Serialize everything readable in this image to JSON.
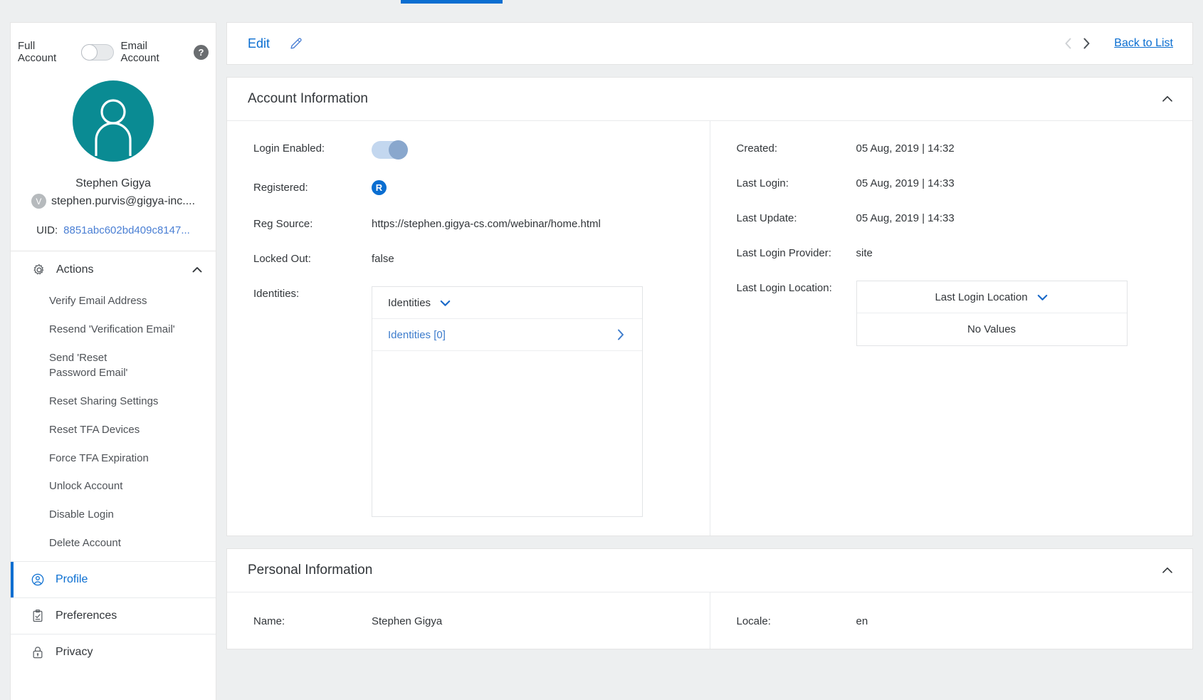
{
  "sidebar": {
    "account_toggle": {
      "left_label": "Full Account",
      "right_label": "Email Account",
      "help_glyph": "?",
      "state": "off"
    },
    "user": {
      "name": "Stephen Gigya",
      "email": "stephen.purvis@gigya-inc....",
      "verified_glyph": "V",
      "uid_label": "UID:",
      "uid_value": "8851abc602bd409c8147..."
    },
    "actions": {
      "title": "Actions",
      "expanded": true,
      "items": [
        {
          "label": "Verify Email Address"
        },
        {
          "label": "Resend 'Verification Email'"
        },
        {
          "label": "Send 'Reset Password Email'"
        },
        {
          "label": "Reset Sharing Settings"
        },
        {
          "label": "Reset TFA Devices"
        },
        {
          "label": "Force TFA Expiration"
        },
        {
          "label": "Unlock Account"
        },
        {
          "label": "Disable Login"
        },
        {
          "label": "Delete Account"
        }
      ]
    },
    "nav": [
      {
        "label": "Profile",
        "icon": "person-circle-icon",
        "active": true
      },
      {
        "label": "Preferences",
        "icon": "clipboard-check-icon",
        "active": false
      },
      {
        "label": "Privacy",
        "icon": "lock-icon",
        "active": false
      }
    ]
  },
  "toolbar": {
    "edit_label": "Edit",
    "edit_icon": "pencil-icon",
    "prev_icon": "chevron-left-icon",
    "next_icon": "chevron-right-icon",
    "back_label": "Back to List"
  },
  "account_information": {
    "title": "Account Information",
    "left_fields": [
      {
        "label": "Login Enabled:",
        "type": "toggle",
        "value": "on"
      },
      {
        "label": "Registered:",
        "type": "badge",
        "value": "R"
      },
      {
        "label": "Reg Source:",
        "type": "text",
        "value": "https://stephen.gigya-cs.com/webinar/home.html"
      },
      {
        "label": "Locked Out:",
        "type": "text",
        "value": "false"
      },
      {
        "label": "Identities:",
        "type": "panel"
      }
    ],
    "identities_panel": {
      "header": "Identities",
      "row_label": "Identities [0]"
    },
    "right_fields": [
      {
        "label": "Created:",
        "type": "text",
        "value": "05 Aug, 2019 | 14:32"
      },
      {
        "label": "Last Login:",
        "type": "text",
        "value": "05 Aug, 2019 | 14:33"
      },
      {
        "label": "Last Update:",
        "type": "text",
        "value": "05 Aug, 2019 | 14:33"
      },
      {
        "label": "Last Login Provider:",
        "type": "text",
        "value": "site"
      },
      {
        "label": "Last Login Location:",
        "type": "panel"
      }
    ],
    "location_panel": {
      "header": "Last Login Location",
      "empty_label": "No Values"
    }
  },
  "personal_information": {
    "title": "Personal Information",
    "name_label": "Name:",
    "name_value": "Stephen Gigya",
    "locale_label": "Locale:",
    "locale_value": "en"
  },
  "colors": {
    "accent_blue": "#0a6ed1",
    "avatar_teal": "#0a8b93",
    "page_bg": "#edeff0",
    "link_blue": "#4a7fd4"
  }
}
